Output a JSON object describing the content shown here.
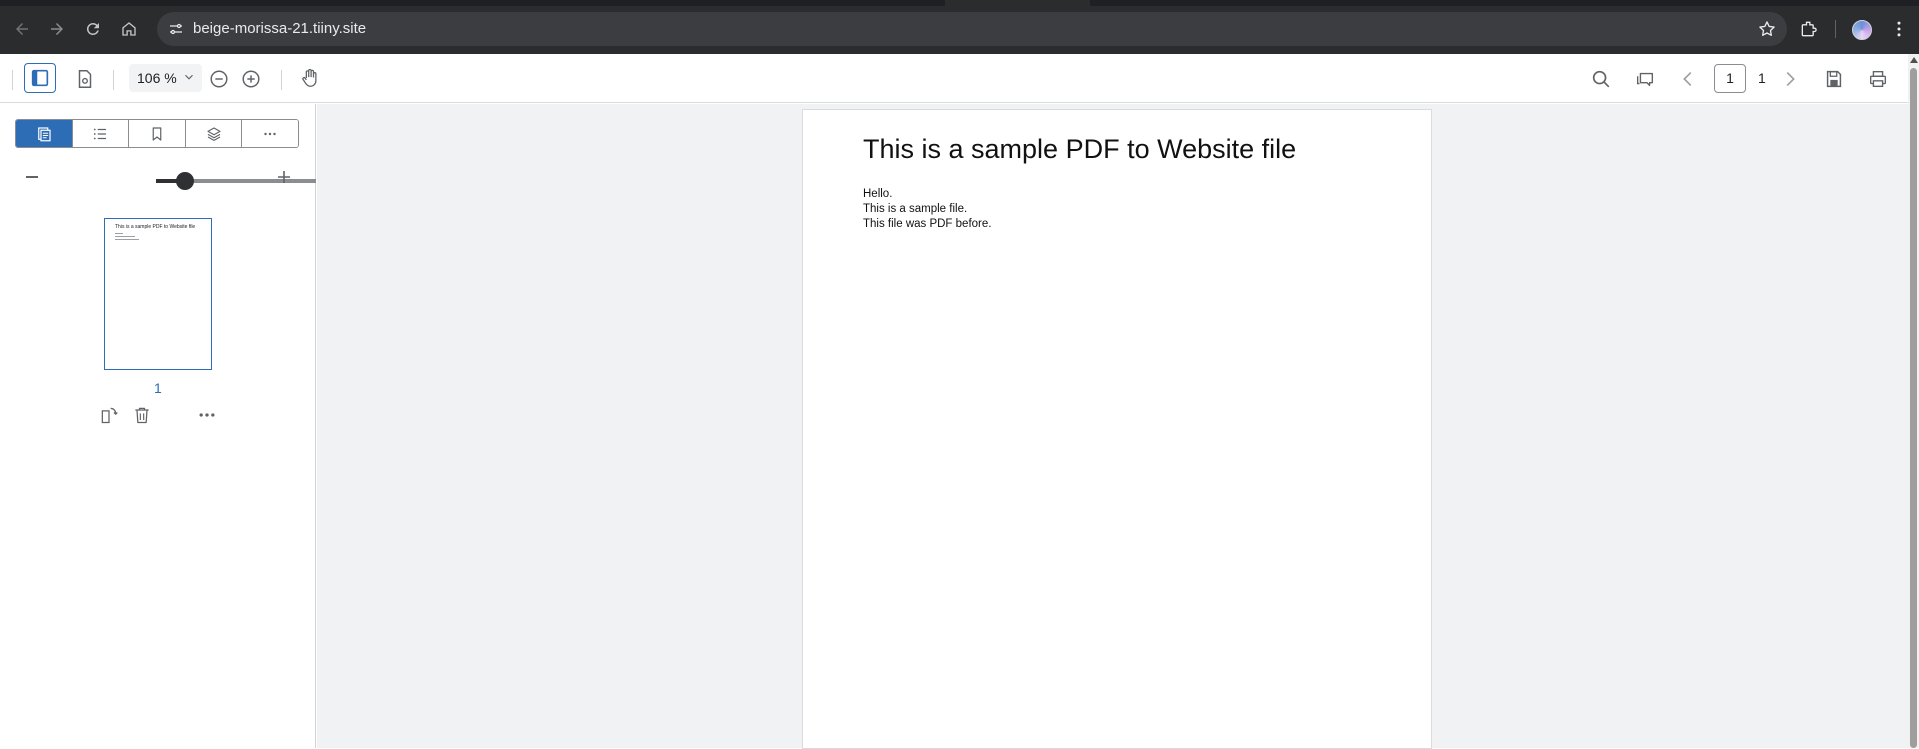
{
  "browser": {
    "url": "beige-morissa-21.tiiny.site",
    "icons": [
      "back-icon",
      "forward-icon",
      "reload-icon",
      "home-icon",
      "site-settings-icon",
      "bookmark-star-icon",
      "extensions-icon",
      "profile-avatar",
      "menu-kebab-icon"
    ]
  },
  "toolbar": {
    "zoom_value": "106 %",
    "current_page": "1",
    "total_pages": "1",
    "icons": [
      "sidebar-toggle-icon",
      "page-settings-icon",
      "zoom-out-icon",
      "zoom-in-icon",
      "pan-hand-icon",
      "search-icon",
      "comments-icon",
      "previous-page-icon",
      "next-page-icon",
      "save-icon",
      "print-icon"
    ]
  },
  "sidebar": {
    "tabs": [
      "thumbnails-icon",
      "outline-list-icon",
      "bookmark-icon",
      "layers-icon",
      "more-icon"
    ],
    "active_tab": 0,
    "thumbnail_zoom_fraction": 0.2,
    "thumbnails": [
      {
        "page_label": "1",
        "title": "This is a sample PDF to Website file"
      }
    ],
    "thumb_actions": [
      "rotate-page-icon",
      "delete-page-icon",
      "more-options-icon"
    ]
  },
  "document": {
    "title": "This is a sample PDF to Website file",
    "lines": [
      "Hello.",
      "This is a sample file.",
      "This file was PDF before."
    ]
  },
  "colors": {
    "accent": "#2d6db5",
    "chrome_bg": "#2b2c2e",
    "omnibox_bg": "#3c3d41",
    "doc_bg": "#f1f2f4"
  }
}
